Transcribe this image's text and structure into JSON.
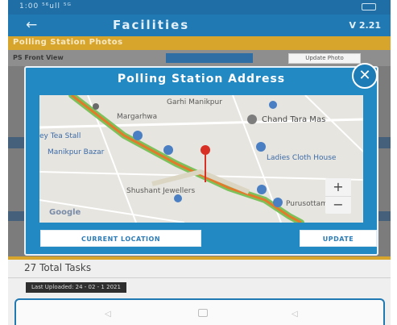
{
  "status_bar": {
    "time_signal": "1:00 ⁵⁶ull ⁵ᴳ",
    "battery_icon": "battery-icon"
  },
  "app_bar": {
    "back_icon": "←",
    "title": "Facilities",
    "version": "V 2.21"
  },
  "section": {
    "title": "Polling Station Photos"
  },
  "background_row": {
    "label": "PS Front View",
    "update_photo": "Update Photo"
  },
  "background_tasks": {
    "total": "27 Total Tasks",
    "last_uploaded": "Last Uploaded: 24 - 02 - 1 2021"
  },
  "dialog": {
    "title": "Polling Station Address",
    "close_icon": "✕",
    "map": {
      "labels": {
        "garhi": "Garhi Manikpur",
        "margarhwa": "Margarhwa",
        "chand": "Chand Tara Mas",
        "tea_stall": "ey Tea Stall",
        "bazar": "Manikpur Bazar",
        "cloth": "Ladies Cloth House",
        "jewellers": "Shushant Jewellers",
        "pump": "Purusottam",
        "google": "Google"
      },
      "zoom_in": "+",
      "zoom_out": "−"
    },
    "buttons": {
      "current_location": "CURRENT LOCATION",
      "update": "UPDATE"
    }
  },
  "nav_bar": {
    "back": "◁",
    "recent": "◁"
  },
  "colors": {
    "primary": "#2079b3",
    "dialog": "#2389c3",
    "accent": "#d8a52c",
    "route": "#e27a2c",
    "green_road": "#7cc25c",
    "marker": "#d93025"
  }
}
